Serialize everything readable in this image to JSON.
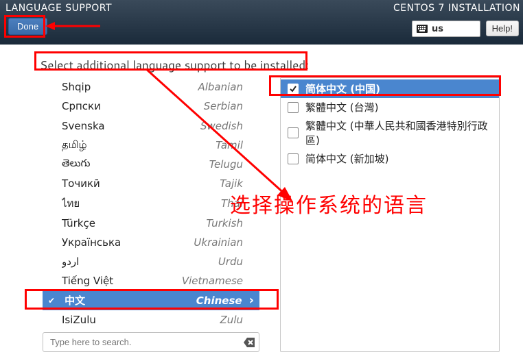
{
  "header": {
    "title": "LANGUAGE SUPPORT",
    "installer": "CENTOS 7 INSTALLATION",
    "done_label": "Done",
    "help_label": "Help!",
    "keyboard_layout": "us"
  },
  "instruction": "Select additional language support to be installed:",
  "search": {
    "placeholder": "Type here to search."
  },
  "selected_language_index": 11,
  "languages": [
    {
      "native": "Shqip",
      "english": "Albanian"
    },
    {
      "native": "Српски",
      "english": "Serbian"
    },
    {
      "native": "Svenska",
      "english": "Swedish"
    },
    {
      "native": "தமிழ்",
      "english": "Tamil"
    },
    {
      "native": "తెలుగు",
      "english": "Telugu"
    },
    {
      "native": "Точикӣ",
      "english": "Tajik"
    },
    {
      "native": "ไทย",
      "english": "Thai"
    },
    {
      "native": "Türkçe",
      "english": "Turkish"
    },
    {
      "native": "Українська",
      "english": "Ukrainian"
    },
    {
      "native": "اردو",
      "english": "Urdu"
    },
    {
      "native": "Tiếng Việt",
      "english": "Vietnamese"
    },
    {
      "native": "中文",
      "english": "Chinese"
    },
    {
      "native": "IsiZulu",
      "english": "Zulu"
    }
  ],
  "variants": [
    {
      "label": "简体中文 (中国)",
      "checked": true
    },
    {
      "label": "繁體中文 (台灣)",
      "checked": false
    },
    {
      "label": "繁體中文 (中華人民共和國香港特別行政區)",
      "checked": false
    },
    {
      "label": "简体中文 (新加坡)",
      "checked": false
    }
  ],
  "annotations": {
    "callout_text": "选择操作系统的语言"
  }
}
